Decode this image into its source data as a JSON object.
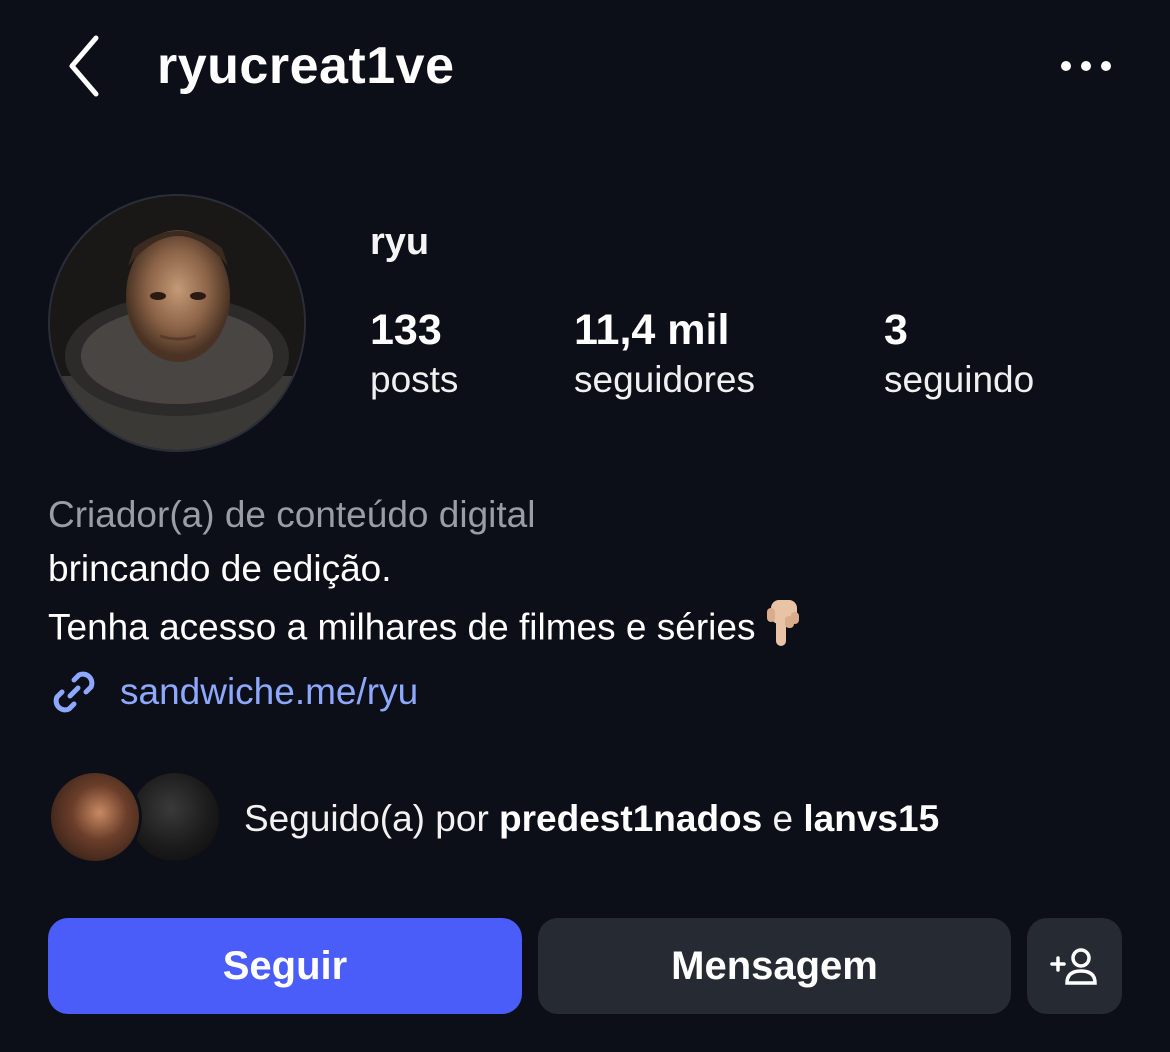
{
  "header": {
    "username": "ryucreat1ve",
    "back_icon": "chevron-left-icon",
    "more_icon": "more-horizontal-icon"
  },
  "profile": {
    "display_name": "ryu",
    "stats": [
      {
        "value": "133",
        "label": "posts"
      },
      {
        "value": "11,4 mil",
        "label": "seguidores"
      },
      {
        "value": "3",
        "label": "seguindo"
      }
    ]
  },
  "bio": {
    "category": "Criador(a) de conteúdo digital",
    "line1": "brincando de edição.",
    "line2": "Tenha acesso a milhares de filmes e séries",
    "line2_emoji": "pointing-down-hand-emoji",
    "link_icon": "link-icon",
    "link": "sandwiche.me/ryu"
  },
  "followed_by": {
    "prefix": "Seguido(a) por",
    "user1": "predest1nados",
    "conjunction": "e",
    "user2": "lanvs15"
  },
  "actions": {
    "follow_label": "Seguir",
    "message_label": "Mensagem",
    "suggest_icon": "add-person-icon"
  },
  "colors": {
    "background": "#0c0f18",
    "follow_button": "#4a5df9",
    "secondary_button": "#262a33",
    "link": "#8ea8ff",
    "muted_text": "#9a9ca6"
  }
}
